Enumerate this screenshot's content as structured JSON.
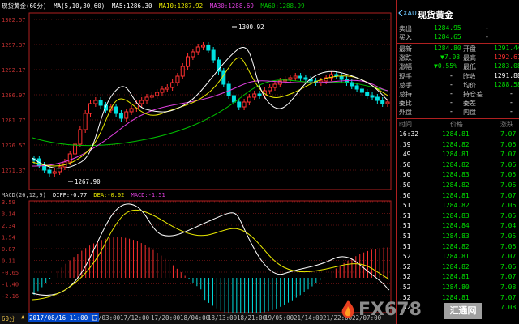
{
  "price_panel": {
    "title": "现货黄金(60分)",
    "indicator_label": "MA(5,10,30,60)",
    "ma5": "MA5:1286.30",
    "ma10": "MA10:1287.92",
    "ma30": "MA30:1288.69",
    "ma60": "MA60:1288.99",
    "y_axis_labels": [
      "1302.57",
      "1297.37",
      "1292.17",
      "1286.97",
      "1281.77",
      "1276.57",
      "1271.37"
    ],
    "high_annotation": "1300.92",
    "low_annotation": "1267.90"
  },
  "macd_panel": {
    "label": "MACD(26,12,9)",
    "diff": "DIFF:-0.77",
    "dea": "DEA:-0.02",
    "macd": "MACD:-1.51",
    "y_axis_labels": [
      "3.59",
      "3.14",
      "2.34",
      "1.54",
      "0.87",
      "0.11",
      "-0.65",
      "-1.40",
      "-2.16"
    ]
  },
  "time_axis": {
    "period": "60分",
    "cursor_time": "2017/08/16 11:00 三",
    "ticks": [
      "17/03:00",
      "17/12:00",
      "17/20:00",
      "18/04:00",
      "18/13:00",
      "18/21:00",
      "19/05:00",
      "21/14:00",
      "21/22:00",
      "22/07:00"
    ]
  },
  "quote": {
    "code": "XAU",
    "name": "现货黄金",
    "sell_label": "卖出",
    "sell_value": "1284.95",
    "sell_extra": "-",
    "buy_label": "买入",
    "buy_value": "1284.65",
    "buy_extra": "-",
    "latest_label": "最新",
    "latest_value": "1284.80",
    "open_label": "开盘",
    "open_value": "1291.44",
    "change_label": "涨跌",
    "change_value": "▼7.08",
    "high_label": "最高",
    "high_value": "1292.61",
    "pct_label": "涨幅",
    "pct_value": "▼0.55%",
    "low_label": "最低",
    "low_value": "1283.08",
    "vol_label": "现手",
    "vol_value": "-",
    "prev_label": "昨收",
    "prev_value": "1291.88",
    "total_label": "总手",
    "total_value": "-",
    "avg_label": "均价",
    "avg_value": "1288.58",
    "hold_label": "总持",
    "hold_value": "-",
    "holdchg_label": "持仓差",
    "holdchg_value": "-",
    "ratio_label": "委比",
    "ratio_value": "-",
    "diff_label": "委差",
    "diff_value": "-",
    "outer_label": "外盘",
    "outer_value": "-",
    "inner_label": "内盘",
    "inner_value": "-"
  },
  "ticks_table": {
    "headers": [
      "时间",
      "价格",
      "涨跌"
    ],
    "rows": [
      {
        "time": "16:32",
        "price": "1284.81",
        "chg": "7.07"
      },
      {
        "time": ".39",
        "price": "1284.82",
        "chg": "7.06"
      },
      {
        "time": ".49",
        "price": "1284.81",
        "chg": "7.07"
      },
      {
        "time": ".50",
        "price": "1284.82",
        "chg": "7.06"
      },
      {
        "time": ".50",
        "price": "1284.83",
        "chg": "7.05"
      },
      {
        "time": ".50",
        "price": "1284.82",
        "chg": "7.06"
      },
      {
        "time": ".50",
        "price": "1284.81",
        "chg": "7.07"
      },
      {
        "time": ".51",
        "price": "1284.82",
        "chg": "7.06"
      },
      {
        "time": ".51",
        "price": "1284.83",
        "chg": "7.05"
      },
      {
        "time": ".51",
        "price": "1284.84",
        "chg": "7.04"
      },
      {
        "time": ".51",
        "price": "1284.83",
        "chg": "7.05"
      },
      {
        "time": ".51",
        "price": "1284.82",
        "chg": "7.06"
      },
      {
        "time": ".52",
        "price": "1284.81",
        "chg": "7.07"
      },
      {
        "time": ".52",
        "price": "1284.82",
        "chg": "7.06"
      },
      {
        "time": ".52",
        "price": "1284.81",
        "chg": "7.07"
      },
      {
        "time": ".52",
        "price": "1284.80",
        "chg": "7.08"
      },
      {
        "time": ".52",
        "price": "1284.81",
        "chg": "7.07"
      },
      {
        "time": ".52",
        "price": "1284.80",
        "chg": "7.08"
      }
    ]
  },
  "watermark": {
    "text": "FX678",
    "tag": "汇通网"
  },
  "colors": {
    "up": "#ff3030",
    "down": "#00e0e0",
    "ma5": "#ffffff",
    "ma10": "#e8e800",
    "ma30": "#e040e0",
    "ma60": "#00c000",
    "diff": "#ffffff",
    "dea": "#e8e800",
    "border": "#b02020",
    "quote_green": "#00e000"
  }
}
